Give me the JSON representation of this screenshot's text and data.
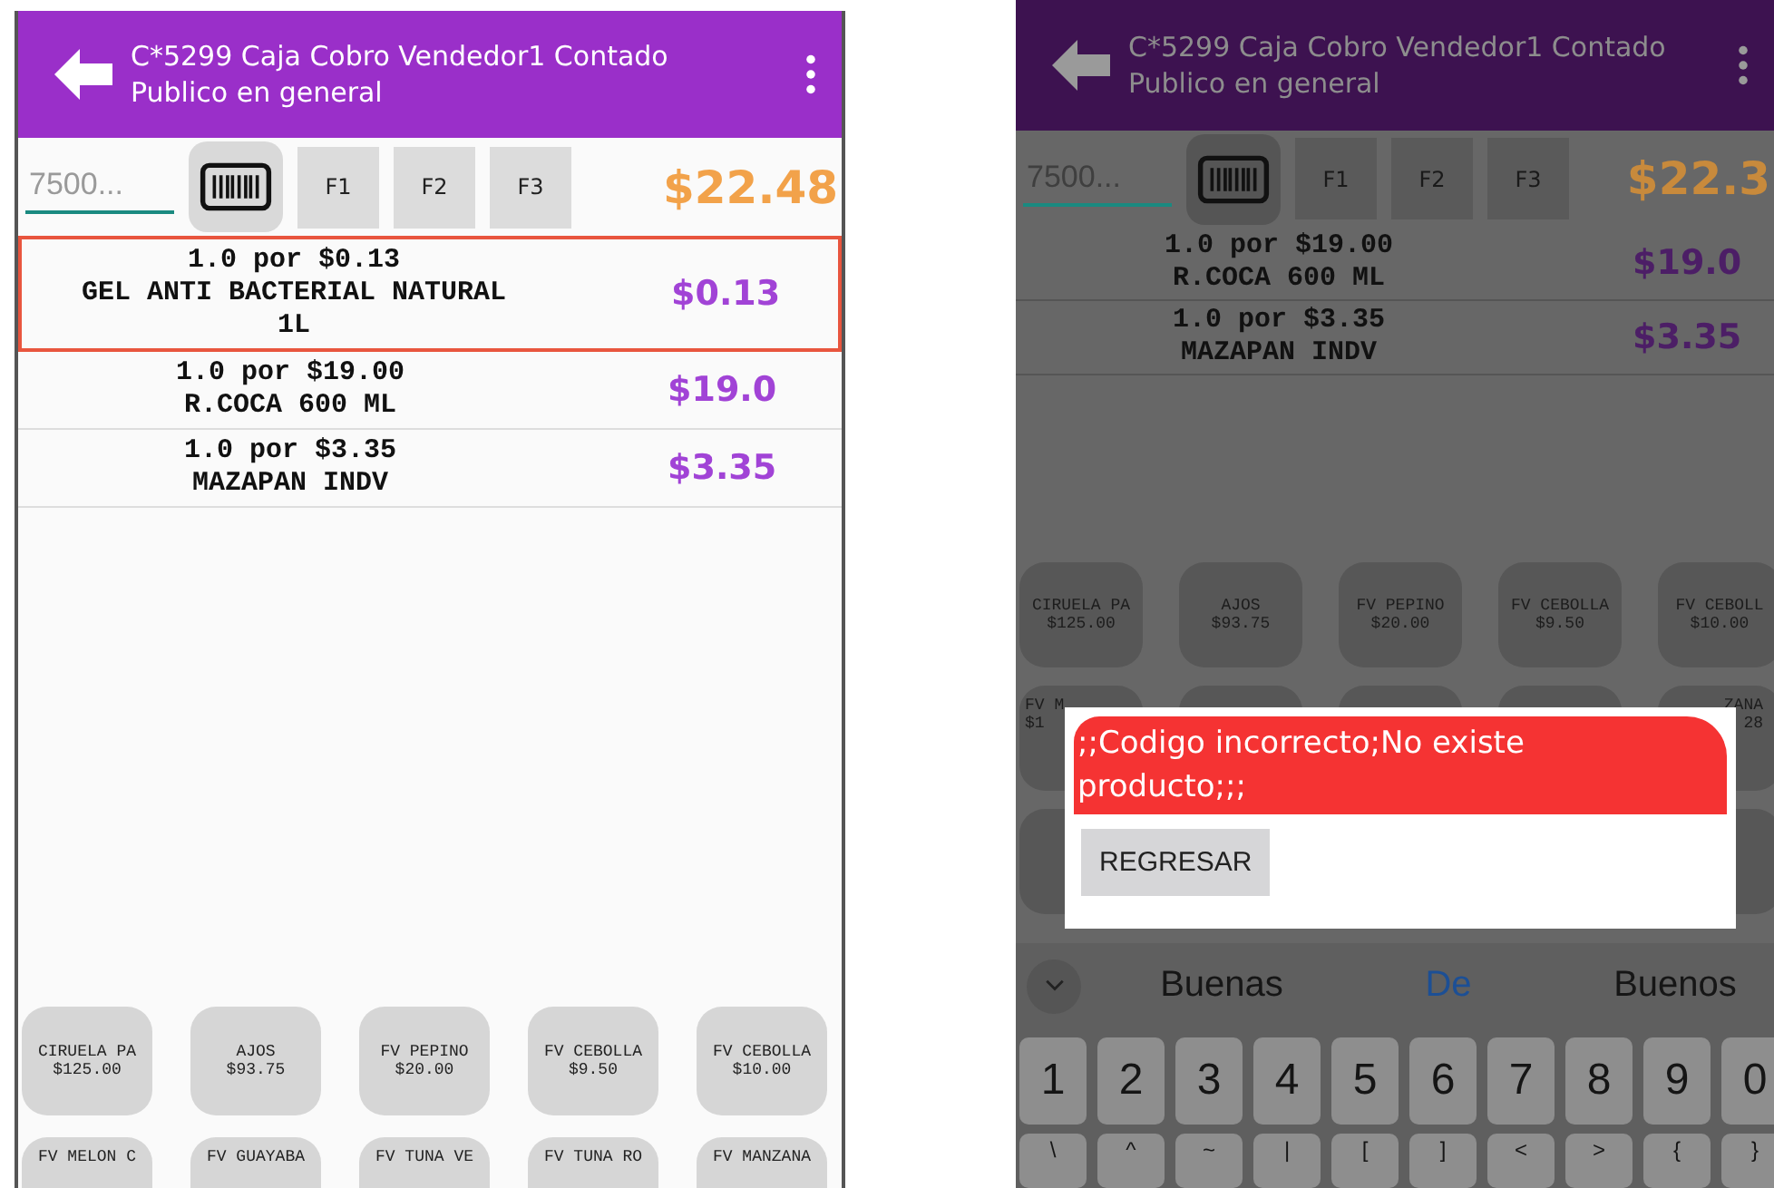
{
  "screens": [
    {
      "kind": "normal",
      "header": {
        "title": "C*5299 Caja Cobro Vendedor1 Contado",
        "subtitle": "Publico en general"
      },
      "search": {
        "placeholder": "7500..."
      },
      "function_keys": [
        "F1",
        "F2",
        "F3"
      ],
      "total": "$22.48",
      "items": [
        {
          "quantity": "1.0 por $0.13",
          "name": "GEL ANTI BACTERIAL NATURAL 1L",
          "price": "$0.13",
          "selected": true
        },
        {
          "quantity": "1.0 por $19.00",
          "name": "R.COCA 600 ML",
          "price": "$19.0",
          "selected": false
        },
        {
          "quantity": "1.0 por $3.35",
          "name": "MAZAPAN INDV",
          "price": "$3.35",
          "selected": false
        }
      ],
      "tile_rows": [
        [
          {
            "name": "CIRUELA PA",
            "price": "$125.00"
          },
          {
            "name": "AJOS",
            "price": "$93.75"
          },
          {
            "name": "FV PEPINO",
            "price": "$20.00"
          },
          {
            "name": "FV CEBOLLA",
            "price": "$9.50"
          },
          {
            "name": "FV CEBOLLA",
            "price": "$10.00"
          }
        ],
        [
          {
            "name": "FV MELON C"
          },
          {
            "name": "FV GUAYABA"
          },
          {
            "name": "FV TUNA VE"
          },
          {
            "name": "FV TUNA RO"
          },
          {
            "name": "FV MANZANA"
          }
        ]
      ]
    },
    {
      "kind": "dimmed",
      "header": {
        "title": "C*5299 Caja Cobro Vendedor1 Contado",
        "subtitle": "Publico en general"
      },
      "search": {
        "placeholder": "7500..."
      },
      "function_keys": [
        "F1",
        "F2",
        "F3"
      ],
      "total": "$22.3",
      "items": [
        {
          "quantity": "1.0 por $19.00",
          "name": "R.COCA 600 ML",
          "price": "$19.0",
          "selected": false
        },
        {
          "quantity": "1.0 por $3.35",
          "name": "MAZAPAN INDV",
          "price": "$3.35",
          "selected": false
        }
      ],
      "tile_rows": [
        [
          {
            "name": "CIRUELA PA",
            "price": "$125.00"
          },
          {
            "name": "AJOS",
            "price": "$93.75"
          },
          {
            "name": "FV PEPINO",
            "price": "$20.00"
          },
          {
            "name": "FV CEBOLLA",
            "price": "$9.50"
          },
          {
            "name": "FV CEBOLL",
            "price": "$10.00"
          }
        ],
        [
          {
            "name": "FV M",
            "price": "$1",
            "kind": "partial"
          },
          {},
          {},
          {},
          {
            "name": "ZANA",
            "price": "28",
            "kind": "partial"
          }
        ],
        [
          {},
          {},
          {},
          {},
          {}
        ]
      ],
      "dialog": {
        "message": ";;Codigo incorrecto;No existe producto;;;",
        "button": "REGRESAR"
      },
      "keyboard": {
        "suggestions": [
          {
            "text": "Buenas",
            "selected": false
          },
          {
            "text": "De",
            "selected": true
          },
          {
            "text": "Buenos",
            "selected": false
          }
        ],
        "rows": [
          [
            "1",
            "2",
            "3",
            "4",
            "5",
            "6",
            "7",
            "8",
            "9",
            "0"
          ],
          [
            "\\",
            "^",
            "~",
            "|",
            "[",
            "]",
            "<",
            ">",
            "{",
            "}"
          ]
        ]
      }
    }
  ]
}
